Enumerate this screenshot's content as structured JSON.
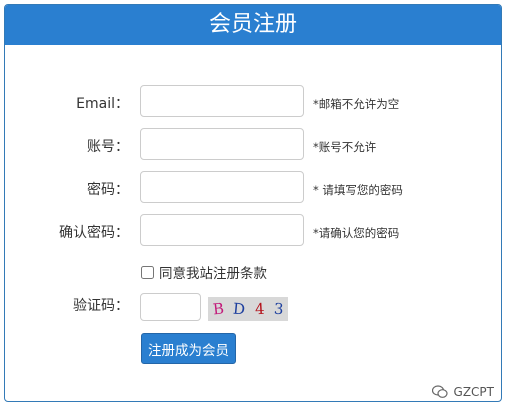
{
  "header": {
    "title": "会员注册"
  },
  "form": {
    "email": {
      "label": "Email：",
      "hint": "*邮箱不允许为空",
      "value": ""
    },
    "account": {
      "label": "账号：",
      "hint": "*账号不允许",
      "value": ""
    },
    "password": {
      "label": "密码：",
      "hint": "* 请填写您的密码",
      "value": ""
    },
    "confirm": {
      "label": "确认密码：",
      "hint": "*请确认您的密码",
      "value": ""
    },
    "agree_label": "同意我站注册条款",
    "captcha": {
      "label": "验证码：",
      "chars": [
        "B",
        "D",
        "4",
        "3"
      ],
      "char_colors": [
        "#c21a7a",
        "#1d3f9e",
        "#b3111a",
        "#1d3f9e"
      ]
    },
    "submit_label": "注册成为会员"
  },
  "watermark": {
    "text": "GZCPT"
  },
  "colors": {
    "accent": "#2a7fd0"
  }
}
